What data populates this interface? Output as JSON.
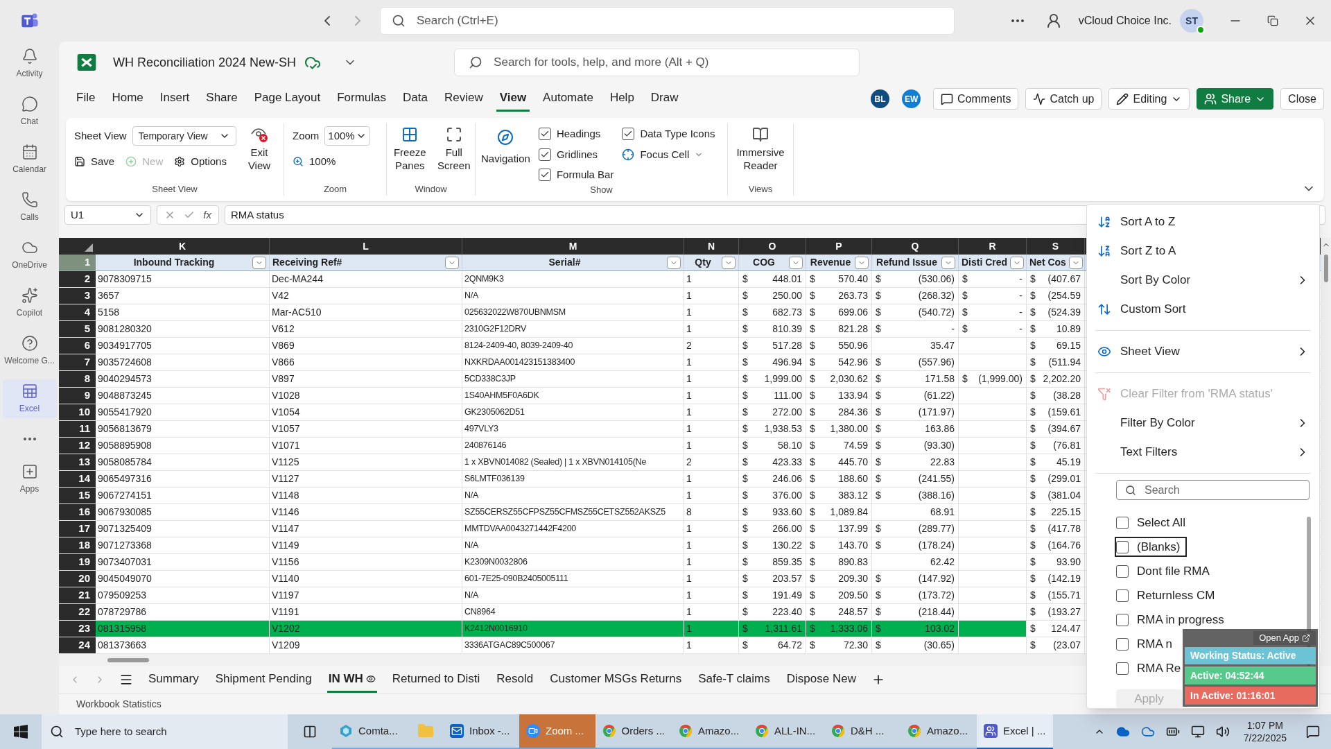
{
  "teams": {
    "search_placeholder": "Search (Ctrl+E)",
    "org": "vCloud Choice Inc.",
    "avatar": "ST"
  },
  "rail": [
    {
      "kind": "activity",
      "label": "Activity",
      "selected": false
    },
    {
      "kind": "chat",
      "label": "Chat",
      "selected": false
    },
    {
      "kind": "calendar",
      "label": "Calendar",
      "selected": false
    },
    {
      "kind": "calls",
      "label": "Calls",
      "selected": false
    },
    {
      "kind": "onedrive",
      "label": "OneDrive",
      "selected": false
    },
    {
      "kind": "copilot",
      "label": "Copilot",
      "selected": false
    },
    {
      "kind": "welcome",
      "label": "Welcome G...",
      "selected": false
    },
    {
      "kind": "excel",
      "label": "Excel",
      "selected": true
    },
    {
      "kind": "more",
      "selected": false
    },
    {
      "kind": "apps",
      "label": "Apps",
      "selected": false
    }
  ],
  "workbook": {
    "title": "WH Reconciliation 2024 New-SH",
    "search_placeholder": "Search for tools, help, and more (Alt + Q)"
  },
  "menu_tabs": [
    {
      "label": "File",
      "selected": false
    },
    {
      "label": "Home",
      "selected": false
    },
    {
      "label": "Insert",
      "selected": false
    },
    {
      "label": "Share",
      "selected": false
    },
    {
      "label": "Page Layout",
      "selected": false
    },
    {
      "label": "Formulas",
      "selected": false
    },
    {
      "label": "Data",
      "selected": false
    },
    {
      "label": "Review",
      "selected": false
    },
    {
      "label": "View",
      "selected": true
    },
    {
      "label": "Automate",
      "selected": false
    },
    {
      "label": "Help",
      "selected": false
    },
    {
      "label": "Draw",
      "selected": false
    }
  ],
  "collaborators": [
    {
      "initials": "BL",
      "color": "#0f4c81"
    },
    {
      "initials": "EW",
      "color": "#0f7fd6"
    }
  ],
  "actions": [
    {
      "label": "Comments",
      "kind": "comments"
    },
    {
      "label": "Catch up",
      "kind": "catchup"
    },
    {
      "label": "Editing",
      "kind": "editing"
    },
    {
      "label": "Share",
      "kind": "share"
    },
    {
      "label": "Close",
      "kind": "close"
    }
  ],
  "ribbon": {
    "sheet_view": {
      "label": "Sheet View",
      "value": "Temporary View",
      "save": "Save",
      "new": {
        "label": "New",
        "disabled": true
      },
      "options": "Options",
      "exit": "Exit View",
      "group": "Sheet View"
    },
    "zoom": {
      "label": "Zoom",
      "value": "100%",
      "reset": "100%",
      "group": "Zoom"
    },
    "window": {
      "freeze": "Freeze Panes",
      "full": "Full Screen",
      "group": "Window"
    },
    "show": {
      "navigation": "Navigation",
      "checks": [
        {
          "label": "Headings",
          "checked": true
        },
        {
          "label": "Gridlines",
          "checked": true
        },
        {
          "label": "Formula Bar",
          "checked": true
        },
        {
          "label": "Data Type Icons",
          "checked": true
        }
      ],
      "focus": "Focus Cell",
      "group": "Show"
    },
    "views": {
      "reader": "Immersive Reader",
      "group": "Views"
    }
  },
  "formula_bar": {
    "name_box": "U1",
    "fx": "fx",
    "content": "RMA status"
  },
  "grid": {
    "columns": [
      {
        "letter": "K",
        "header": "Inbound Tracking"
      },
      {
        "letter": "L",
        "header": "Receiving Ref#"
      },
      {
        "letter": "M",
        "header": "Serial#"
      },
      {
        "letter": "N",
        "header": "Qty"
      },
      {
        "letter": "O",
        "header": "COG"
      },
      {
        "letter": "P",
        "header": "Revenue"
      },
      {
        "letter": "Q",
        "header": "Refund Issue"
      },
      {
        "letter": "R",
        "header": "Disti Cred"
      },
      {
        "letter": "S",
        "header": "Net Cos"
      }
    ],
    "header_row": "1",
    "rows": [
      {
        "num": "2",
        "highlight": false,
        "cells": [
          "9078309715",
          "Dec-MA244",
          "2QNM9K3",
          "1",
          [
            "$",
            "448.01"
          ],
          [
            "$",
            "570.40"
          ],
          [
            "$",
            "(530.06)"
          ],
          [
            "$",
            "-"
          ],
          [
            "$",
            "(407.67"
          ]
        ]
      },
      {
        "num": "3",
        "highlight": false,
        "cells": [
          "3657",
          "V42",
          "N/A",
          "1",
          [
            "$",
            "250.00"
          ],
          [
            "$",
            "263.73"
          ],
          [
            "$",
            "(268.32)"
          ],
          [
            "$",
            "-"
          ],
          [
            "$",
            "(254.59"
          ]
        ]
      },
      {
        "num": "4",
        "highlight": false,
        "cells": [
          "5158",
          "Mar-AC510",
          "025632022W870UBNMSM",
          "1",
          [
            "$",
            "682.73"
          ],
          [
            "$",
            "699.06"
          ],
          [
            "$",
            "(540.72)"
          ],
          [
            "$",
            "-"
          ],
          [
            "$",
            "(524.39"
          ]
        ]
      },
      {
        "num": "5",
        "highlight": false,
        "cells": [
          "9081280320",
          "V612",
          "2310G2F12DRV",
          "1",
          [
            "$",
            "810.39"
          ],
          [
            "$",
            "821.28"
          ],
          [
            "$",
            "-"
          ],
          [
            "$",
            "-"
          ],
          [
            "$",
            "10.89"
          ]
        ]
      },
      {
        "num": "6",
        "highlight": false,
        "cells": [
          "9034917705",
          "V869",
          "8124-2409-40, 8039-2409-40",
          "2",
          [
            "$",
            "517.28"
          ],
          [
            "$",
            "550.96"
          ],
          [
            "35.47"
          ],
          null,
          [
            "$",
            "69.15"
          ]
        ]
      },
      {
        "num": "7",
        "highlight": false,
        "cells": [
          "9035724608",
          "V866",
          "NXKRDAA001423151383400",
          "1",
          [
            "$",
            "496.94"
          ],
          [
            "$",
            "542.96"
          ],
          [
            "$",
            "(557.96)"
          ],
          null,
          [
            "$",
            "(511.94"
          ]
        ]
      },
      {
        "num": "8",
        "highlight": false,
        "cells": [
          "9040294573",
          "V897",
          "5CD338C3JP",
          "1",
          [
            "$",
            "1,999.00"
          ],
          [
            "$",
            "2,030.62"
          ],
          [
            "$",
            "171.58"
          ],
          [
            "$",
            "(1,999.00)"
          ],
          [
            "$",
            "2,202.20"
          ]
        ]
      },
      {
        "num": "9",
        "highlight": false,
        "cells": [
          "9048873245",
          "V1028",
          "1S40AHM5F0A6DK",
          "1",
          [
            "$",
            "111.00"
          ],
          [
            "$",
            "133.94"
          ],
          [
            "$",
            "(61.22)"
          ],
          null,
          [
            "$",
            "(38.28"
          ]
        ]
      },
      {
        "num": "10",
        "highlight": false,
        "cells": [
          "9055417920",
          "V1054",
          "GK2305062D51",
          "1",
          [
            "$",
            "272.00"
          ],
          [
            "$",
            "284.36"
          ],
          [
            "$",
            "(171.97)"
          ],
          null,
          [
            "$",
            "(159.61"
          ]
        ]
      },
      {
        "num": "11",
        "highlight": false,
        "cells": [
          "9056813679",
          "V1057",
          "497VLY3",
          "1",
          [
            "$",
            "1,938.53"
          ],
          [
            "$",
            "1,380.00"
          ],
          [
            "$",
            "163.86"
          ],
          null,
          [
            "$",
            "(394.67"
          ]
        ]
      },
      {
        "num": "12",
        "highlight": false,
        "cells": [
          "9058895908",
          "V1071",
          "240876146",
          "1",
          [
            "$",
            "58.10"
          ],
          [
            "$",
            "74.59"
          ],
          [
            "$",
            "(93.30)"
          ],
          null,
          [
            "$",
            "(76.81"
          ]
        ]
      },
      {
        "num": "13",
        "highlight": false,
        "cells": [
          "9058085784",
          "V1125",
          "1 x XBVN014082 (Sealed) | 1 x XBVN014105(Ne",
          "2",
          [
            "$",
            "423.33"
          ],
          [
            "$",
            "445.70"
          ],
          [
            "$",
            "22.83"
          ],
          null,
          [
            "$",
            "45.19"
          ]
        ]
      },
      {
        "num": "14",
        "highlight": false,
        "cells": [
          "9065497316",
          "V1127",
          "S6LMTF036139",
          "1",
          [
            "$",
            "246.06"
          ],
          [
            "$",
            "188.60"
          ],
          [
            "$",
            "(241.55)"
          ],
          null,
          [
            "$",
            "(299.01"
          ]
        ]
      },
      {
        "num": "15",
        "highlight": false,
        "cells": [
          "9067274151",
          "V1148",
          "N/A",
          "1",
          [
            "$",
            "376.00"
          ],
          [
            "$",
            "383.12"
          ],
          [
            "$",
            "(388.16)"
          ],
          null,
          [
            "$",
            "(381.04"
          ]
        ]
      },
      {
        "num": "16",
        "highlight": false,
        "cells": [
          "9067930085",
          "V1146",
          "SZ55CERSZ55CFPSZ55CFMSZ55CETSZ552AKSZ5",
          "8",
          [
            "$",
            "933.60"
          ],
          [
            "$",
            "1,089.84"
          ],
          [
            "68.91"
          ],
          null,
          [
            "$",
            "225.15"
          ]
        ]
      },
      {
        "num": "17",
        "highlight": false,
        "cells": [
          "9071325409",
          "V1147",
          "MMTDVAA0043271442F4200",
          "1",
          [
            "$",
            "266.00"
          ],
          [
            "$",
            "137.99"
          ],
          [
            "$",
            "(289.77)"
          ],
          null,
          [
            "$",
            "(417.78"
          ]
        ]
      },
      {
        "num": "18",
        "highlight": false,
        "cells": [
          "9071273368",
          "V1149",
          "N/A",
          "1",
          [
            "$",
            "130.22"
          ],
          [
            "$",
            "143.70"
          ],
          [
            "$",
            "(178.24)"
          ],
          null,
          [
            "$",
            "(164.76"
          ]
        ]
      },
      {
        "num": "19",
        "highlight": false,
        "cells": [
          "9073407031",
          "V1156",
          "K2309N0032806",
          "1",
          [
            "$",
            "859.35"
          ],
          [
            "$",
            "890.83"
          ],
          [
            "62.42"
          ],
          null,
          [
            "$",
            "93.90"
          ]
        ]
      },
      {
        "num": "20",
        "highlight": false,
        "cells": [
          "9045049070",
          "V1140",
          "601-7E25-090B2405005111",
          "1",
          [
            "$",
            "203.57"
          ],
          [
            "$",
            "209.30"
          ],
          [
            "$",
            "(147.92)"
          ],
          null,
          [
            "$",
            "(142.19"
          ]
        ]
      },
      {
        "num": "21",
        "highlight": false,
        "cells": [
          "079509253",
          "V1197",
          "N/A",
          "1",
          [
            "$",
            "191.49"
          ],
          [
            "$",
            "209.50"
          ],
          [
            "$",
            "(173.72)"
          ],
          null,
          [
            "$",
            "(155.71"
          ]
        ]
      },
      {
        "num": "22",
        "highlight": false,
        "cells": [
          "078729786",
          "V1191",
          "CN8964",
          "1",
          [
            "$",
            "223.40"
          ],
          [
            "$",
            "248.57"
          ],
          [
            "$",
            "(218.44)"
          ],
          null,
          [
            "$",
            "(193.27"
          ]
        ]
      },
      {
        "num": "23",
        "highlight": true,
        "cells": [
          "081315958",
          "V1202",
          "K2412N0016910",
          "1",
          [
            "$",
            "1,311.61"
          ],
          [
            "$",
            "1,333.06"
          ],
          [
            "$",
            "103.02"
          ],
          null,
          [
            "$",
            "124.47"
          ]
        ]
      },
      {
        "num": "24",
        "highlight": false,
        "cells": [
          "081373663",
          "V1209",
          "3336ATGAC89C500067",
          "1",
          [
            "$",
            "64.72"
          ],
          [
            "$",
            "72.30"
          ],
          [
            "$",
            "(30.65)"
          ],
          null,
          [
            "$",
            "(23.07"
          ]
        ]
      }
    ]
  },
  "filter_menu": {
    "items": [
      {
        "kind": "sort_asc",
        "label": "Sort A to Z",
        "disabled": false
      },
      {
        "kind": "sort_desc",
        "label": "Sort Z to A",
        "disabled": false
      },
      {
        "kind": "submenu",
        "label": "Sort By Color",
        "disabled": false
      },
      {
        "kind": "custom",
        "label": "Custom Sort",
        "disabled": false
      },
      {
        "kind": "divider"
      },
      {
        "kind": "sheetview",
        "label": "Sheet View",
        "disabled": false
      },
      {
        "kind": "divider"
      },
      {
        "kind": "clear",
        "label": "Clear Filter from 'RMA status'",
        "disabled": true
      },
      {
        "kind": "submenu",
        "label": "Filter By Color",
        "disabled": false
      },
      {
        "kind": "submenu",
        "label": "Text Filters",
        "disabled": false
      },
      {
        "kind": "divider"
      }
    ],
    "search_placeholder": "Search",
    "values": [
      {
        "label": "Select All",
        "checked": false,
        "focused": false
      },
      {
        "label": "(Blanks)",
        "checked": false,
        "focused": true
      },
      {
        "label": "Dont file RMA",
        "checked": false,
        "focused": false
      },
      {
        "label": "Returnless CM",
        "checked": false,
        "focused": false
      },
      {
        "label": "RMA in progress",
        "checked": false,
        "focused": false
      },
      {
        "label": "RMA n",
        "checked": false,
        "focused": false
      },
      {
        "label": "RMA Re",
        "checked": false,
        "focused": false
      }
    ],
    "apply": {
      "label": "Apply",
      "disabled": true
    }
  },
  "status_widget": {
    "open_app": "Open App",
    "status": "Working Status: Active",
    "active": "Active: 04:52:44",
    "inactive": "In Active: 01:16:01"
  },
  "sheet_tabs": [
    {
      "label": "Summary",
      "selected": false
    },
    {
      "label": "Shipment Pending",
      "selected": false
    },
    {
      "label": "IN WH",
      "selected": true
    },
    {
      "label": "Returned to Disti",
      "selected": false
    },
    {
      "label": "Resold",
      "selected": false
    },
    {
      "label": "Customer MSGs Returns",
      "selected": false
    },
    {
      "label": "Safe-T claims",
      "selected": false
    },
    {
      "label": "Dispose New",
      "selected": false
    }
  ],
  "status_bar": {
    "text": "Workbook Statistics"
  },
  "taskbar": {
    "search_placeholder": "Type here to search",
    "apps": [
      {
        "kind": "app",
        "label": "Comta...",
        "selected": false,
        "flashing": false
      },
      {
        "kind": "folder",
        "selected": false,
        "flashing": false
      },
      {
        "kind": "outlook",
        "label": "Inbox -...",
        "selected": false,
        "flashing": false
      },
      {
        "kind": "zoom",
        "label": "Zoom ...",
        "selected": false,
        "flashing": true
      },
      {
        "kind": "chrome",
        "label": "Orders ...",
        "selected": false,
        "flashing": false
      },
      {
        "kind": "chrome",
        "label": "Amazo...",
        "selected": false,
        "flashing": false
      },
      {
        "kind": "chrome",
        "label": "ALL-IN...",
        "selected": false,
        "flashing": false
      },
      {
        "kind": "chrome",
        "label": "D&H ...",
        "selected": false,
        "flashing": false
      },
      {
        "kind": "chrome",
        "label": "Amazo...",
        "selected": false,
        "flashing": false
      },
      {
        "kind": "teams",
        "label": "Excel | ...",
        "selected": true,
        "flashing": false
      }
    ],
    "time": "1:07 PM",
    "date": "7/22/2025"
  }
}
